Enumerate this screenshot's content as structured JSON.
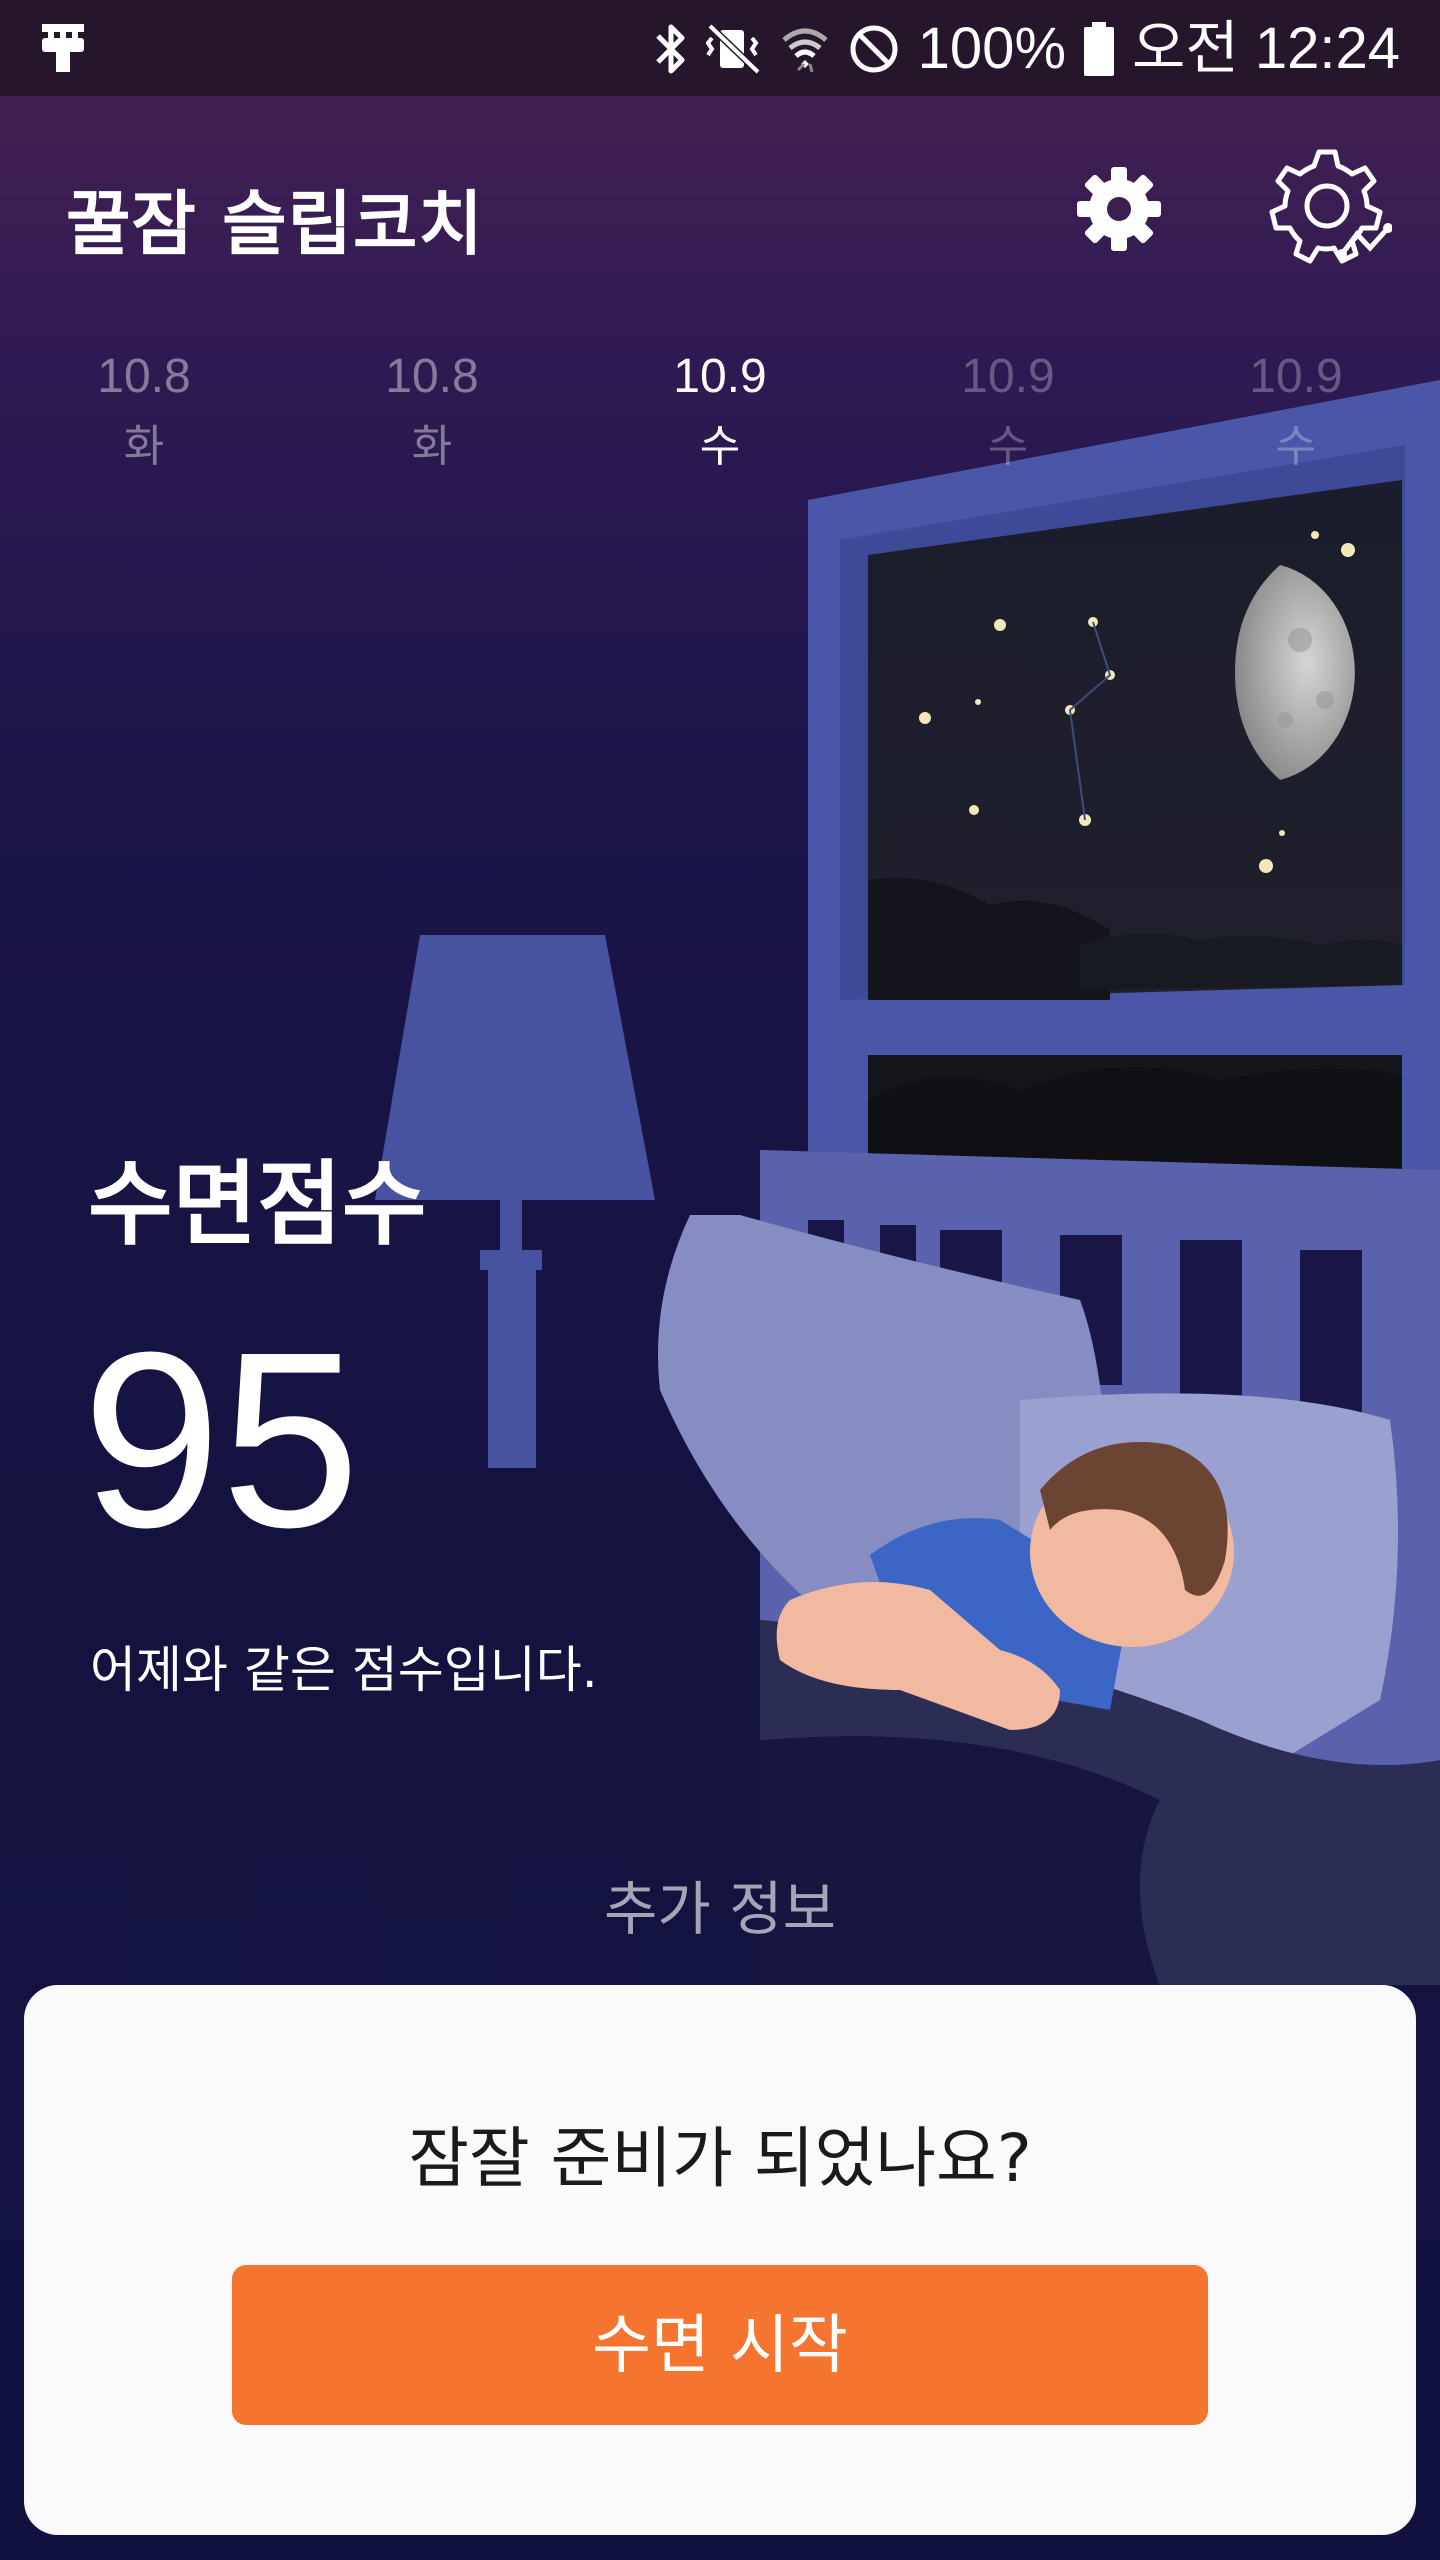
{
  "status_bar": {
    "battery": "100%",
    "time": "오전 12:24",
    "icons": [
      "plug-icon",
      "bluetooth-icon",
      "vibrate-icon",
      "wifi-icon",
      "do-not-disturb-icon",
      "battery-icon"
    ]
  },
  "header": {
    "title": "꿀잠 슬립코치",
    "actions": [
      "settings-gear-icon",
      "sleep-settings-icon"
    ]
  },
  "date_tabs": [
    {
      "date": "10.8",
      "day": "화",
      "state": "inactive"
    },
    {
      "date": "10.8",
      "day": "화",
      "state": "inactive"
    },
    {
      "date": "10.9",
      "day": "수",
      "state": "active"
    },
    {
      "date": "10.9",
      "day": "수",
      "state": "inactive"
    },
    {
      "date": "10.9",
      "day": "수",
      "state": "dim"
    }
  ],
  "score": {
    "label": "수면점수",
    "value": "95",
    "comment": "어제와 같은 점수입니다."
  },
  "more_info": "추가 정보",
  "card": {
    "question": "잠잘 준비가 되었나요?",
    "button_label": "수면 시작"
  },
  "colors": {
    "accent": "#f47430",
    "background_top": "#4a2354",
    "background_bottom": "#121240",
    "card": "#fafafa"
  }
}
